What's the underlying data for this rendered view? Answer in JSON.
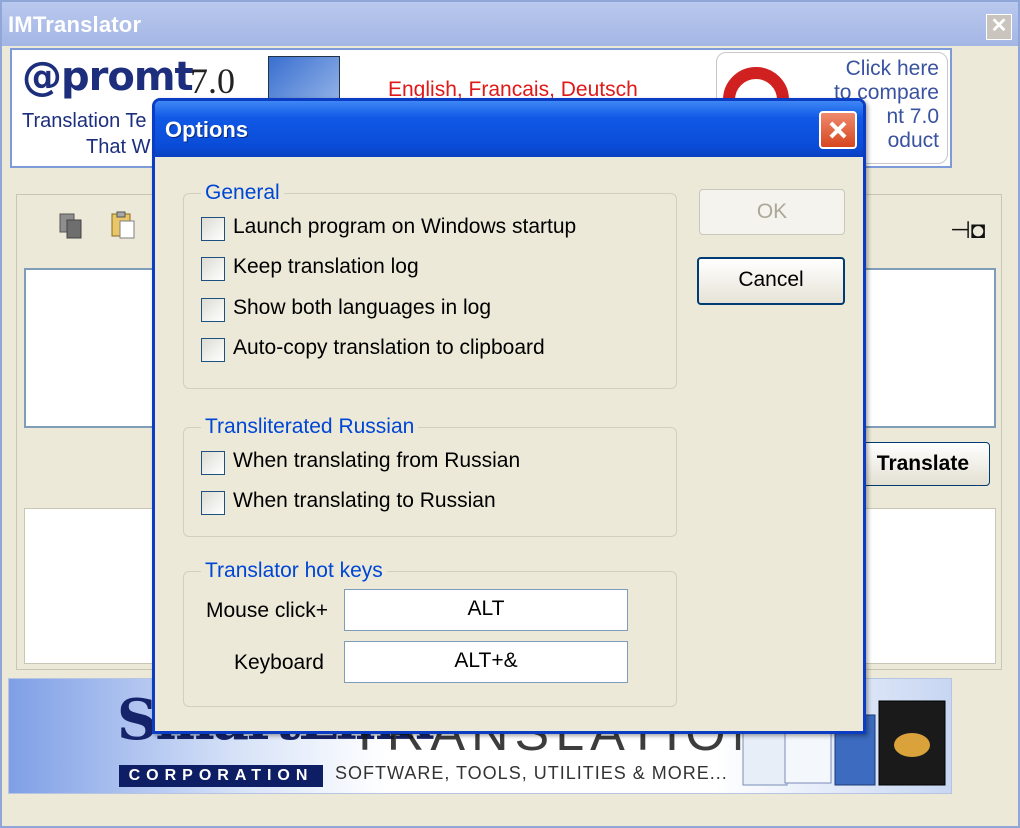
{
  "main_window": {
    "title": "IMTranslator",
    "close_glyph": "✕"
  },
  "promt_banner": {
    "logo": "@promt",
    "version": "7.0",
    "tagline_line1": "Translation Te",
    "tagline_line2": "That W",
    "languages": "English, Francais, Deutsch",
    "cta": "Click here\nto compare\nnt 7.0\noduct"
  },
  "panel": {
    "translate_label": "Translate",
    "pin_glyph": "⊣◘"
  },
  "smartlink_banner": {
    "brand": "SmartLink",
    "corporation": "CORPORATION",
    "headline": "TRANSLATION",
    "subline": "SOFTWARE, TOOLS, UTILITIES & MORE..."
  },
  "options_dialog": {
    "title": "Options",
    "ok_label": "OK",
    "cancel_label": "Cancel",
    "general": {
      "legend": "General",
      "options": [
        {
          "label": "Launch program on Windows startup",
          "checked": false
        },
        {
          "label": "Keep translation log",
          "checked": false
        },
        {
          "label": "Show both languages in log",
          "checked": false
        },
        {
          "label": "Auto-copy translation to clipboard",
          "checked": false
        }
      ]
    },
    "transliterated": {
      "legend": "Transliterated Russian",
      "options": [
        {
          "label": "When translating from Russian",
          "checked": false
        },
        {
          "label": "When translating to Russian",
          "checked": false
        }
      ]
    },
    "hotkeys": {
      "legend": "Translator hot keys",
      "mouse_label": "Mouse click+",
      "mouse_value": "ALT",
      "keyboard_label": "Keyboard",
      "keyboard_value": "ALT+&"
    }
  }
}
